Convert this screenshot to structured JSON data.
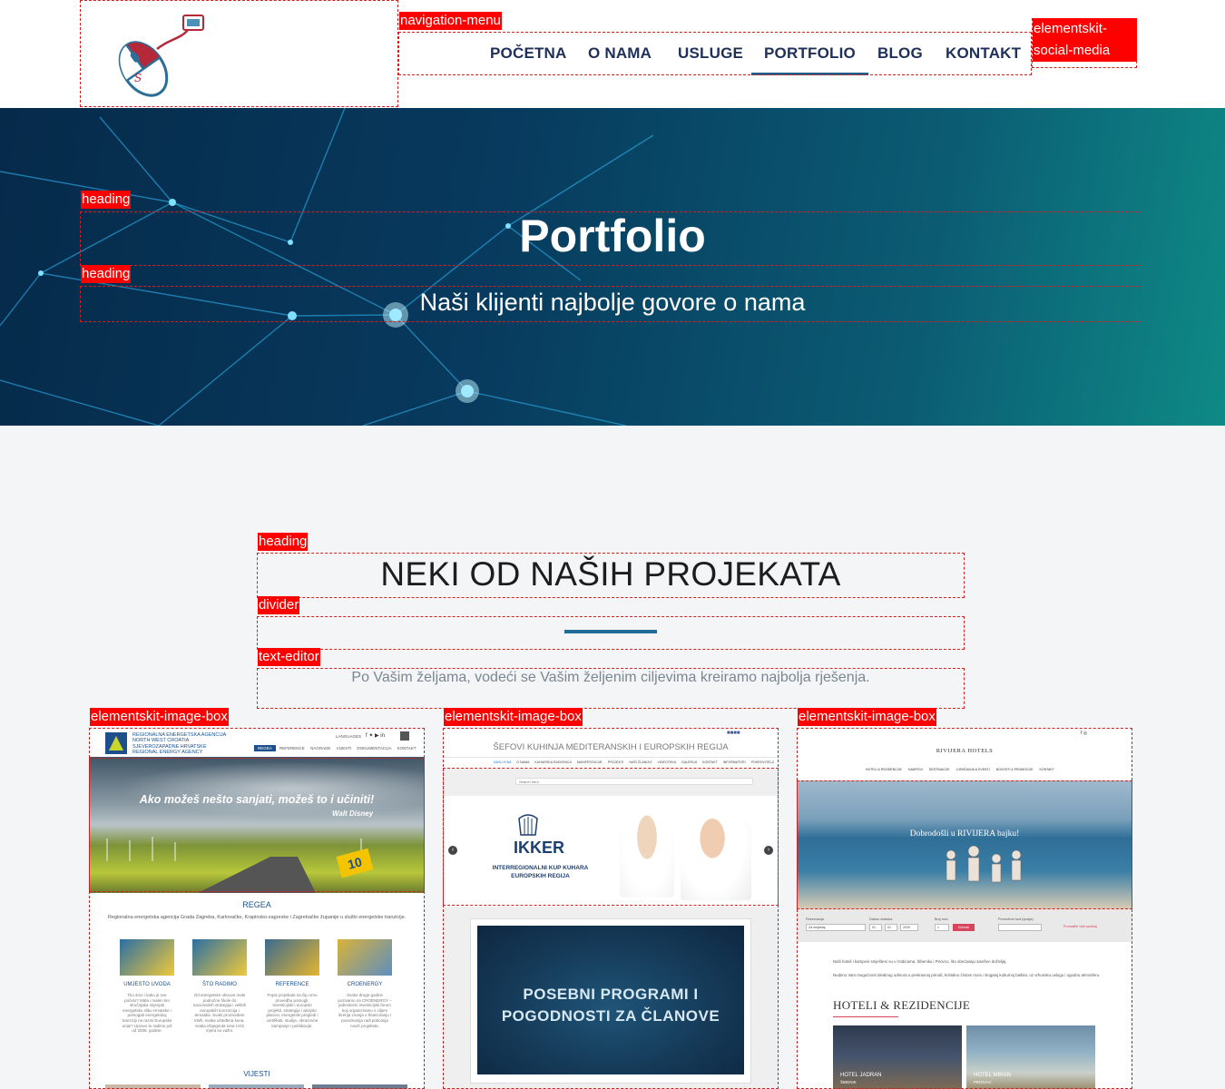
{
  "nav": {
    "items": [
      {
        "label": "POČETNA"
      },
      {
        "label": "O NAMA"
      },
      {
        "label": "USLUGE"
      },
      {
        "label": "PORTFOLIO",
        "active": true
      },
      {
        "label": "BLOG"
      },
      {
        "label": "KONTAKT"
      }
    ]
  },
  "hero": {
    "title": "Portfolio",
    "subtitle": "Naši klijenti najbolje govore o nama"
  },
  "section": {
    "title": "NEKI OD NAŠIH PROJEKATA",
    "text": "Po Vašim željama, vodeći se Vašim željenim ciljevima kreiramo najbolja rješenja."
  },
  "overlay_tags": {
    "navigation": "navigation-menu",
    "social": "elementskit-social-media",
    "heading": "heading",
    "divider": "divider",
    "text_editor": "text-editor",
    "image_box": "elementskit-image-box"
  },
  "cards": [
    {
      "agency_lines": [
        "REGIONALNA ENERGETSKA AGENCIJA",
        "NORTH WEST CROATIA",
        "SJEVEROZAPADNE HRVATSKE",
        "REGIONAL ENERGY AGENCY"
      ],
      "menu": [
        "REGEA",
        "REFERENCE",
        "NAGRADE",
        "VIJESTI",
        "DOKUMENTACIJA",
        "KONTAKT"
      ],
      "languages": "LANGUAGES",
      "quote": "Ako možeš nešto sanjati, možeš to i učiniti!",
      "quote_author": "Walt Disney",
      "badge": "10",
      "heading": "REGEA",
      "intro": "Regionalna energetska agencija Grada Zagreba, Karlovačke, Krapinsko-zagorske i Zagrebačke županije u službi energetske tranzicije.",
      "tiles": [
        {
          "title": "UMJESTO UVODA",
          "text": "Tko smo i kako je sve počelo? Mala i malen tim stručnjaka mijenjati energetsku sliku Hrvatske i pomogati energetskoj tranziciji na razini Europske unije? Upravo to radimo još od 2008. godine."
        },
        {
          "title": "ŠTO RADIMO",
          "text": "Od energetske obnove male područne škole do nacionalnih strategija i velikih europskih konzorcija i tematika. Svaki proizvedeni kWh, svaka ušteđena kuna, svaka izbjegnuta tona CO2 mjera su važni."
        },
        {
          "title": "REFERENCE",
          "text": "Popis projekata na čiju smo provedbu pomogli. Investicijski i europski projekti, strategija i akcijski planovi, energetski pregledi i certifikati, studije, obrazovne kampanje i publikacije."
        },
        {
          "title": "CROENERGY",
          "text": "Svake druge godine pozivamo na CROENERGY – jedinstveni investicijski forum koji organiziramo s ciljem širenja znanja o financiranju i povezivanja radi poticanja novih projekata."
        }
      ],
      "news_heading": "VIJESTI"
    },
    {
      "site_title": "ŠEFOVI KUHINJA MEDITERANSKIH I EUROPSKIH REGIJA",
      "menu": [
        "NASLOVNA",
        "O NAMA",
        "KUHARSKA RADIONICA",
        "MANIFESTACIJE",
        "PROJEKTI",
        "NAŠI ČLANOVI",
        "VIDEOTEKA",
        "GALERIJA",
        "KONTAKT",
        "INFORMATORI",
        "POKROVITELJI"
      ],
      "search_placeholder": "Search here",
      "brand": "IKKER",
      "brand_sub": "INTERREGIONALNI KUP KUHARA EUROPSKIH REGIJA",
      "promo": "POSEBNI PROGRAMI I POGODNOSTI ZA ČLANOVE"
    },
    {
      "brand": "RIVIJERA HOTELS",
      "menu": [
        "HOTELI & REZIDENCIJE",
        "KAMPOVI",
        "DESTINACIJE",
        "VJENČANJA & EVENTI",
        "NOVOSTI & PROMOCIJE",
        "KONTAKT"
      ],
      "hero_text": "Dobrodošli u RIVIJERA bajku!",
      "booking_labels": [
        "Rezervacija",
        "Datum dolaska",
        "Broj noći",
        "Promotivni kod (opcija)"
      ],
      "booking_values": [
        "Za smještaj",
        "01",
        "01",
        "2020",
        "1"
      ],
      "booking_button": "Dohvati",
      "promo_link": "Pronađite Vaš sadržaj",
      "intro_1": "Naši hoteli i kampovi smješteni su u Vodicama, Šibeniku i Pirovcu, što obećavaju savršen doživljaj.",
      "intro_2": "Nudimo Vam mogućnost idealnog odmora u prekrasnoj prirodi, kristalno čistom moru i bogatoj kulturnoj baštini, uz vrhunsku uslugu i ugodnu atmosferu.",
      "section_heading": "HOTELI & REZIDENCIJE",
      "hotels": [
        {
          "name": "HOTEL JADRAN",
          "place": "ŠIBENIK"
        },
        {
          "name": "HOTEL MIRAN",
          "place": "PIROVAC"
        }
      ]
    }
  ],
  "colors": {
    "nav_text": "#1e2f5a",
    "accent": "#1e6e98",
    "overlay": "#ff0000"
  }
}
